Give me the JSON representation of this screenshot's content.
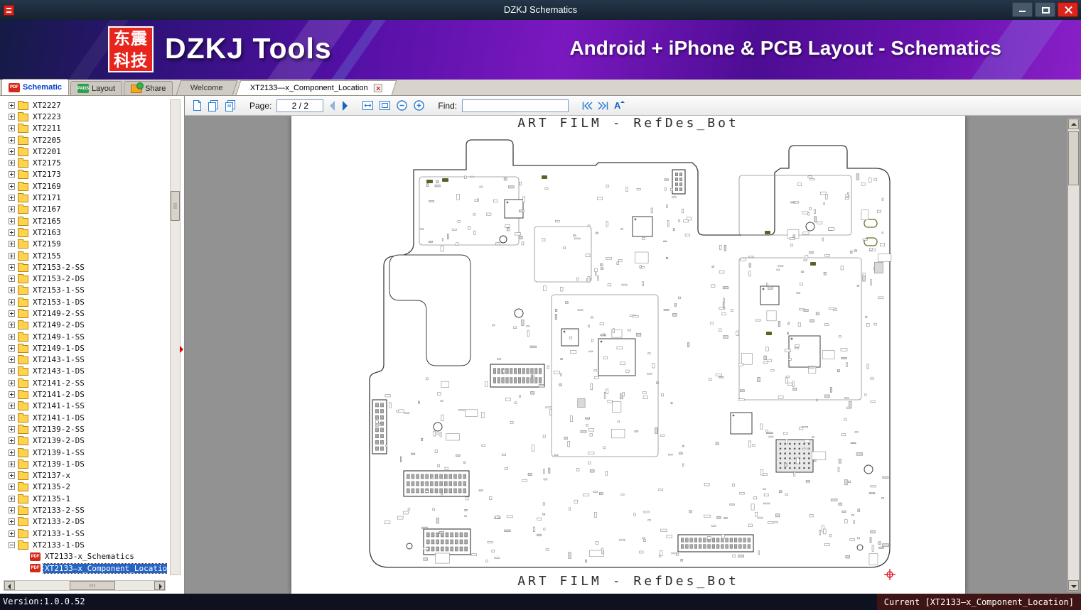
{
  "window": {
    "title": "DZKJ Schematics"
  },
  "banner": {
    "logo_line1": "东震",
    "logo_line2": "科技",
    "app_name": "DZKJ Tools",
    "tagline": "Android + iPhone & PCB Layout - Schematics"
  },
  "badges": {
    "pdf": "PDF",
    "pads": "PADS"
  },
  "tabs": {
    "schematic": "Schematic",
    "layout": "Layout",
    "share": "Share",
    "welcome": "Welcome",
    "document": "XT2133—x_Component_Location"
  },
  "toolbar": {
    "page_label": "Page:",
    "page_value": "2 / 2",
    "find_label": "Find:",
    "find_value": ""
  },
  "sidebar": {
    "items": [
      {
        "label": "XT2227",
        "icon": "folder",
        "level": 0,
        "toggle": "plus"
      },
      {
        "label": "XT2223",
        "icon": "folder",
        "level": 0,
        "toggle": "plus"
      },
      {
        "label": "XT2211",
        "icon": "folder",
        "level": 0,
        "toggle": "plus"
      },
      {
        "label": "XT2205",
        "icon": "folder",
        "level": 0,
        "toggle": "plus"
      },
      {
        "label": "XT2201",
        "icon": "folder",
        "level": 0,
        "toggle": "plus"
      },
      {
        "label": "XT2175",
        "icon": "folder",
        "level": 0,
        "toggle": "plus"
      },
      {
        "label": "XT2173",
        "icon": "folder",
        "level": 0,
        "toggle": "plus"
      },
      {
        "label": "XT2169",
        "icon": "folder",
        "level": 0,
        "toggle": "plus"
      },
      {
        "label": "XT2171",
        "icon": "folder",
        "level": 0,
        "toggle": "plus"
      },
      {
        "label": "XT2167",
        "icon": "folder",
        "level": 0,
        "toggle": "plus"
      },
      {
        "label": "XT2165",
        "icon": "folder",
        "level": 0,
        "toggle": "plus"
      },
      {
        "label": "XT2163",
        "icon": "folder",
        "level": 0,
        "toggle": "plus"
      },
      {
        "label": "XT2159",
        "icon": "folder",
        "level": 0,
        "toggle": "plus"
      },
      {
        "label": "XT2155",
        "icon": "folder",
        "level": 0,
        "toggle": "plus"
      },
      {
        "label": "XT2153-2-SS",
        "icon": "folder",
        "level": 0,
        "toggle": "plus"
      },
      {
        "label": "XT2153-2-DS",
        "icon": "folder",
        "level": 0,
        "toggle": "plus"
      },
      {
        "label": "XT2153-1-SS",
        "icon": "folder",
        "level": 0,
        "toggle": "plus"
      },
      {
        "label": "XT2153-1-DS",
        "icon": "folder",
        "level": 0,
        "toggle": "plus"
      },
      {
        "label": "XT2149-2-SS",
        "icon": "folder",
        "level": 0,
        "toggle": "plus"
      },
      {
        "label": "XT2149-2-DS",
        "icon": "folder",
        "level": 0,
        "toggle": "plus"
      },
      {
        "label": "XT2149-1-SS",
        "icon": "folder",
        "level": 0,
        "toggle": "plus"
      },
      {
        "label": "XT2149-1-DS",
        "icon": "folder",
        "level": 0,
        "toggle": "plus"
      },
      {
        "label": "XT2143-1-SS",
        "icon": "folder",
        "level": 0,
        "toggle": "plus"
      },
      {
        "label": "XT2143-1-DS",
        "icon": "folder",
        "level": 0,
        "toggle": "plus"
      },
      {
        "label": "XT2141-2-SS",
        "icon": "folder",
        "level": 0,
        "toggle": "plus"
      },
      {
        "label": "XT2141-2-DS",
        "icon": "folder",
        "level": 0,
        "toggle": "plus"
      },
      {
        "label": "XT2141-1-SS",
        "icon": "folder",
        "level": 0,
        "toggle": "plus"
      },
      {
        "label": "XT2141-1-DS",
        "icon": "folder",
        "level": 0,
        "toggle": "plus"
      },
      {
        "label": "XT2139-2-SS",
        "icon": "folder",
        "level": 0,
        "toggle": "plus"
      },
      {
        "label": "XT2139-2-DS",
        "icon": "folder",
        "level": 0,
        "toggle": "plus"
      },
      {
        "label": "XT2139-1-SS",
        "icon": "folder",
        "level": 0,
        "toggle": "plus"
      },
      {
        "label": "XT2139-1-DS",
        "icon": "folder",
        "level": 0,
        "toggle": "plus"
      },
      {
        "label": "XT2137-x",
        "icon": "folder",
        "level": 0,
        "toggle": "plus"
      },
      {
        "label": "XT2135-2",
        "icon": "folder",
        "level": 0,
        "toggle": "plus"
      },
      {
        "label": "XT2135-1",
        "icon": "folder",
        "level": 0,
        "toggle": "plus"
      },
      {
        "label": "XT2133-2-SS",
        "icon": "folder",
        "level": 0,
        "toggle": "plus"
      },
      {
        "label": "XT2133-2-DS",
        "icon": "folder",
        "level": 0,
        "toggle": "plus"
      },
      {
        "label": "XT2133-1-SS",
        "icon": "folder",
        "level": 0,
        "toggle": "plus"
      },
      {
        "label": "XT2133-1-DS",
        "icon": "folder",
        "level": 0,
        "toggle": "minus"
      },
      {
        "label": "XT2133-x_Schematics",
        "icon": "pdf",
        "level": 1,
        "toggle": null
      },
      {
        "label": "XT2133—x_Component_Location",
        "icon": "pdf",
        "level": 1,
        "toggle": null,
        "selected": true
      }
    ]
  },
  "document": {
    "header": "ART FILM - RefDes_Bot",
    "footer": "ART FILM - RefDes_Bot"
  },
  "statusbar": {
    "version": "Version:1.0.0.52",
    "current": "Current [XT2133—x_Component_Location]"
  },
  "colors": {
    "accent_blue": "#1565c0",
    "selection_blue": "#2563c4",
    "close_red": "#d9251d",
    "logo_red": "#e8251c",
    "banner_purple": "#6812ae"
  }
}
